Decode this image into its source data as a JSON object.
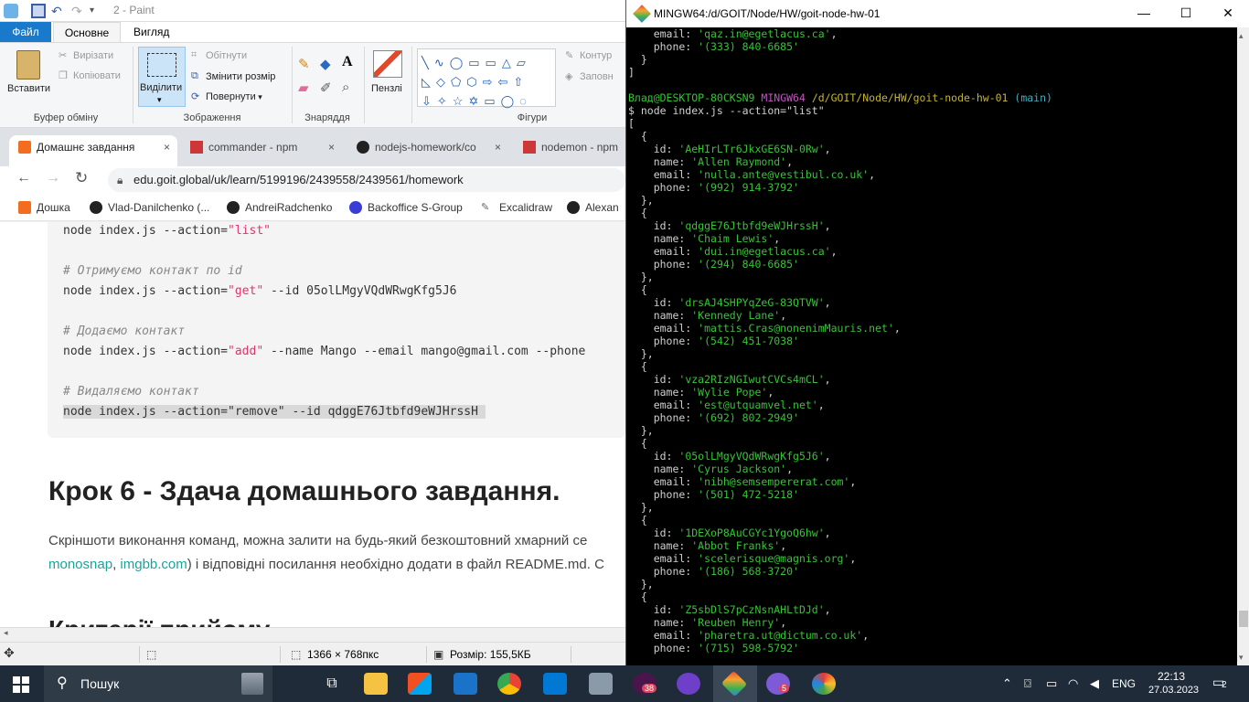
{
  "paint": {
    "title": "2 - Paint",
    "menu_tabs": [
      "Файл",
      "Основне",
      "Вигляд"
    ],
    "clipboard": {
      "paste": "Вставити",
      "cut": "Вирізати",
      "copy": "Копіювати",
      "group": "Буфер обміну"
    },
    "image": {
      "select": "Виділити",
      "crop": "Обітнути",
      "resize": "Змінити розмір",
      "rotate": "Повернути",
      "group": "Зображення"
    },
    "tools": {
      "group": "Знаряддя"
    },
    "brushes": {
      "label": "Пензлі"
    },
    "shapes": {
      "outline": "Контур",
      "fill": "Заповн",
      "group": "Фігури"
    },
    "status": {
      "dimensions": "1366 × 768пкс",
      "size": "Розмір: 155,5КБ"
    }
  },
  "browser": {
    "tabs": [
      {
        "label": "Домашнє завдання",
        "close": "×"
      },
      {
        "label": "commander - npm",
        "close": "×"
      },
      {
        "label": "nodejs-homework/co",
        "close": "×"
      },
      {
        "label": "nodemon - npm",
        "close": "×"
      }
    ],
    "url": "edu.goit.global/uk/learn/5199196/2439558/2439561/homework",
    "bookmarks": [
      "Дошка",
      "Vlad-Danilchenko (...",
      "AndreiRadchenko",
      "Backoffice S-Group",
      "Excalidraw",
      "Alexan"
    ],
    "page": {
      "code_lines": [
        {
          "pre": "node index.js --action=",
          "str": "\"list\"",
          "post": ""
        },
        {
          "comment": "# Отримуємо контакт по id"
        },
        {
          "pre": "node index.js --action=",
          "str": "\"get\"",
          "post": " --id 05olLMgyVQdWRwgKfg5J6"
        },
        {
          "comment": "# Додаємо контакт"
        },
        {
          "pre": "node index.js --action=",
          "str": "\"add\"",
          "post": " --name Mango --email mango@gmail.com --phone"
        },
        {
          "comment": "# Видаляємо контакт"
        },
        {
          "highlight": "node index.js --action=\"remove\" --id qdggE76Jtbfd9eWJHrssH "
        }
      ],
      "heading": "Крок 6 - Здача домашнього завдання.",
      "para1": "Скріншоти виконання команд, можна залити на будь-який безкоштовний хмарний се",
      "para2_link1": "monosnap",
      "para2_sep": ", ",
      "para2_link2": "imgbb.com",
      "para2_rest": ") і відповідні посилання необхідно додати в файл README.md. С",
      "next_heading": "Критерії прийому"
    }
  },
  "terminal": {
    "title": "MINGW64:/d/GOIT/Node/HW/goit-node-hw-01",
    "prompt_user": "Влад@DESKTOP-80CKSN9",
    "prompt_env": "MINGW64",
    "prompt_path": "/d/GOIT/Node/HW/goit-node-hw-01",
    "prompt_branch": "(main)",
    "command": "$ node index.js --action=\"list\"",
    "prev_email": "'qaz.in@egetlacus.ca'",
    "prev_phone": "'(333) 840-6685'",
    "contacts": [
      {
        "id": "'AeHIrLTr6JkxGE6SN-0Rw'",
        "name": "'Allen Raymond'",
        "email": "'nulla.ante@vestibul.co.uk'",
        "phone": "'(992) 914-3792'"
      },
      {
        "id": "'qdggE76Jtbfd9eWJHrssH'",
        "name": "'Chaim Lewis'",
        "email": "'dui.in@egetlacus.ca'",
        "phone": "'(294) 840-6685'"
      },
      {
        "id": "'drsAJ4SHPYqZeG-83QTVW'",
        "name": "'Kennedy Lane'",
        "email": "'mattis.Cras@nonenimMauris.net'",
        "phone": "'(542) 451-7038'"
      },
      {
        "id": "'vza2RIzNGIwutCVCs4mCL'",
        "name": "'Wylie Pope'",
        "email": "'est@utquamvel.net'",
        "phone": "'(692) 802-2949'"
      },
      {
        "id": "'05olLMgyVQdWRwgKfg5J6'",
        "name": "'Cyrus Jackson'",
        "email": "'nibh@semsempererat.com'",
        "phone": "'(501) 472-5218'"
      },
      {
        "id": "'1DEXoP8AuCGYc1YgoQ6hw'",
        "name": "'Abbot Franks'",
        "email": "'scelerisque@magnis.org'",
        "phone": "'(186) 568-3720'"
      },
      {
        "id": "'Z5sbDlS7pCzNsnAHLtDJd'",
        "name": "'Reuben Henry'",
        "email": "'pharetra.ut@dictum.co.uk'",
        "phone": "'(715) 598-5792'"
      }
    ]
  },
  "taskbar": {
    "search": "Пошук",
    "badge_1": "38",
    "badge_2": "5",
    "lang": "ENG",
    "time": "22:13",
    "date": "27.03.2023",
    "notifications": "2"
  }
}
